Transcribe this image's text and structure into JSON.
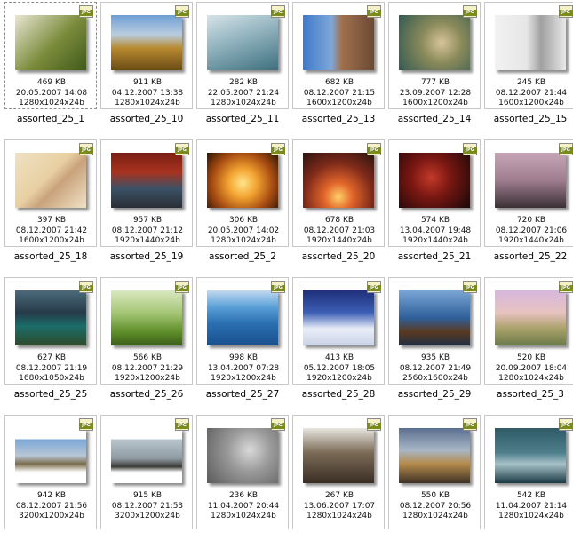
{
  "file_type_badge": "JPG",
  "items": [
    {
      "name": "assorted_25_1",
      "size": "469 KB",
      "date": "20.05.2007 14:08",
      "dims": "1280x1024x24b",
      "selected": true,
      "bg": "linear-gradient(135deg,#e8e6d2 0%,#7a8a3a 55%,#3f5a1c 100%)"
    },
    {
      "name": "assorted_25_10",
      "size": "911 KB",
      "date": "04.12.2007 13:38",
      "dims": "1280x1024x24b",
      "bg": "linear-gradient(180deg,#6f9ed3 0%,#b9cde0 35%,#b88a2f 60%,#6a4a16 100%)"
    },
    {
      "name": "assorted_25_11",
      "size": "282 KB",
      "date": "22.05.2007 21:24",
      "dims": "1280x1024x24b",
      "bg": "linear-gradient(160deg,#d6e4e8 0%,#8fb1bd 45%,#3e6f7e 100%)"
    },
    {
      "name": "assorted_25_13",
      "size": "682 KB",
      "date": "08.12.2007 21:15",
      "dims": "1600x1200x24b",
      "bg": "linear-gradient(90deg,#3f79c9 0%,#7ea7d9 40%,#a0704d 55%,#6b4a34 100%)"
    },
    {
      "name": "assorted_25_14",
      "size": "777 KB",
      "date": "23.09.2007 12:28",
      "dims": "1600x1200x24b",
      "bg": "radial-gradient(circle at 60% 50%,#d8c49a 0%,#8a8a5a 40%,#335a52 100%)"
    },
    {
      "name": "assorted_25_15",
      "size": "245 KB",
      "date": "08.12.2007 21:44",
      "dims": "1600x1200x24b",
      "bg": "linear-gradient(90deg,#f2f2f2 0%,#e6e6e6 45%,#a0a0a0 65%,#e8e8e8 100%)"
    },
    {
      "name": "assorted_25_18",
      "size": "397 KB",
      "date": "08.12.2007 21:42",
      "dims": "1600x1200x24b",
      "bg": "linear-gradient(135deg,#efe1c2 0%,#e8cfa2 45%,#c9a27c 60%,#f0e2c6 100%)"
    },
    {
      "name": "assorted_25_19",
      "size": "957 KB",
      "date": "08.12.2007 21:12",
      "dims": "1920x1440x24b",
      "bg": "linear-gradient(180deg,#7a1f14 0%,#a8321f 35%,#3b5266 65%,#2a2e36 100%)"
    },
    {
      "name": "assorted_25_2",
      "size": "306 KB",
      "date": "20.05.2007 14:02",
      "dims": "1280x1024x24b",
      "bg": "radial-gradient(circle at 50% 55%,#ffe58a 0%,#f3a431 30%,#a64b12 65%,#2a1406 100%)"
    },
    {
      "name": "assorted_25_20",
      "size": "678 KB",
      "date": "08.12.2007 21:03",
      "dims": "1920x1440x24b",
      "bg": "radial-gradient(circle at 50% 80%,#ffcf6a 0%,#e2662a 25%,#7e2a1a 60%,#2a1410 100%)"
    },
    {
      "name": "assorted_25_21",
      "size": "574 KB",
      "date": "13.04.2007 19:48",
      "dims": "1920x1440x24b",
      "bg": "radial-gradient(circle at 45% 45%,#c23a2a 0%,#7a1712 40%,#180808 100%)"
    },
    {
      "name": "assorted_25_22",
      "size": "720 KB",
      "date": "08.12.2007 21:06",
      "dims": "1920x1440x24b",
      "bg": "linear-gradient(180deg,#c6a6b6 0%,#9f7d8e 50%,#3b3036 100%)"
    },
    {
      "name": "assorted_25_25",
      "size": "627 KB",
      "date": "08.12.2007 21:19",
      "dims": "1680x1050x24b",
      "bg": "linear-gradient(180deg,#4c6a7a 0%,#263b4a 40%,#1b6d6a 65%,#2e4a2a 100%)"
    },
    {
      "name": "assorted_25_26",
      "size": "566 KB",
      "date": "08.12.2007 21:29",
      "dims": "1920x1200x24b",
      "bg": "linear-gradient(180deg,#d9e8c0 0%,#a6c677 40%,#5f8f2a 75%,#3b5f1a 100%)"
    },
    {
      "name": "assorted_25_27",
      "size": "998 KB",
      "date": "13.04.2007 07:28",
      "dims": "1920x1200x24b",
      "bg": "linear-gradient(180deg,#c3d9ef 0%,#5aa0d8 30%,#2a6fb0 60%,#1a4f8f 100%)"
    },
    {
      "name": "assorted_25_28",
      "size": "413 KB",
      "date": "05.12.2007 18:05",
      "dims": "1920x1200x24b",
      "bg": "linear-gradient(180deg,#1f2f7a 0%,#3c5fb5 40%,#e9eef8 70%,#c9d2e6 100%)"
    },
    {
      "name": "assorted_25_29",
      "size": "935 KB",
      "date": "08.12.2007 21:49",
      "dims": "2560x1600x24b",
      "bg": "linear-gradient(180deg,#7aa6d6 0%,#2f5f9a 50%,#5a3a20 75%,#1f2e44 100%)"
    },
    {
      "name": "assorted_25_3",
      "size": "520 KB",
      "date": "20.09.2007 18:04",
      "dims": "1280x1024x24b",
      "bg": "linear-gradient(180deg,#d7b7de 0%,#e7c3c0 40%,#a8a06a 70%,#6b7a4a 100%)"
    },
    {
      "name": "",
      "size": "942 KB",
      "date": "08.12.2007 21:56",
      "dims": "3200x1200x24b",
      "bg": "linear-gradient(180deg,#ffffff 0%,#ffffff 20%,#7aa6d6 20%,#b8c7d6 50%,#7a6b4a 65%,#ffffff 80%,#ffffff 100%)"
    },
    {
      "name": "",
      "size": "915 KB",
      "date": "08.12.2007 21:53",
      "dims": "3200x1200x24b",
      "bg": "linear-gradient(180deg,#ffffff 0%,#ffffff 20%,#b9c6cf 20%,#8f9aa2 55%,#3b3b36 70%,#ffffff 80%,#ffffff 100%)"
    },
    {
      "name": "",
      "size": "236 KB",
      "date": "11.04.2007 20:44",
      "dims": "1280x1024x24b",
      "bg": "radial-gradient(circle at 60% 40%,#d9d9d9 0%,#9a9a9a 40%,#5a5a5a 100%)"
    },
    {
      "name": "",
      "size": "267 KB",
      "date": "13.06.2007 17:07",
      "dims": "1280x1024x24b",
      "bg": "linear-gradient(180deg,#e8e6e0 0%,#7a6a56 45%,#3a2e24 100%)"
    },
    {
      "name": "",
      "size": "550 KB",
      "date": "08.12.2007 20:56",
      "dims": "1280x1024x24b",
      "bg": "linear-gradient(180deg,#5a6f8f 0%,#a8b6c6 40%,#b48a4a 65%,#3f3226 100%)"
    },
    {
      "name": "",
      "size": "542 KB",
      "date": "11.04.2007 21:14",
      "dims": "1280x1024x24b",
      "bg": "linear-gradient(180deg,#2f5a66 0%,#4f7f8c 45%,#a7c1c8 65%,#1a3a44 100%)"
    }
  ]
}
